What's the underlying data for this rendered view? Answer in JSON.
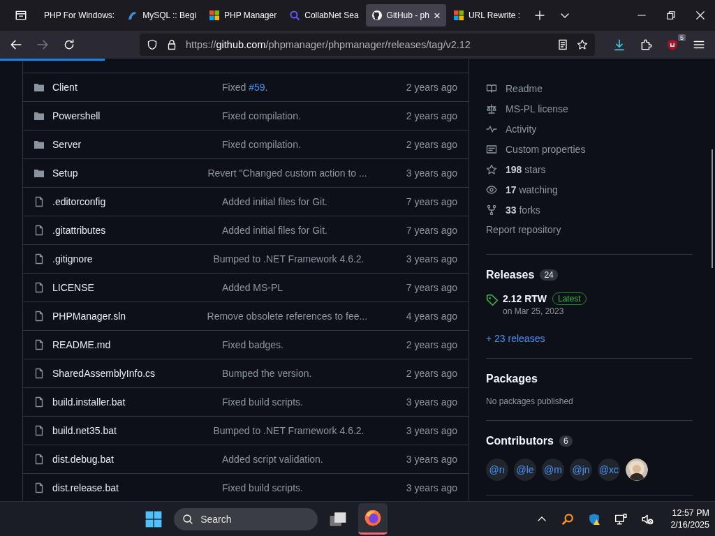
{
  "browser": {
    "tabs": [
      {
        "title": "PHP For Windows:",
        "selected": false
      },
      {
        "title": "MySQL :: Begi",
        "selected": false
      },
      {
        "title": "PHP Manager",
        "selected": false
      },
      {
        "title": "CollabNet Sea",
        "selected": false
      },
      {
        "title": "GitHub - ph",
        "selected": true,
        "close": "×"
      },
      {
        "title": "URL Rewrite :",
        "selected": false
      }
    ],
    "address": {
      "scheme": "https://",
      "domain": "github.com",
      "path": "/phpmanager/phpmanager/releases/tag/v2.12"
    },
    "extension_badge": "5"
  },
  "files": [
    {
      "kind": "folder",
      "name": "Client",
      "message": "Fixed ",
      "link": "#59",
      "message_end": ".",
      "date": "2 years ago"
    },
    {
      "kind": "folder",
      "name": "Powershell",
      "message": "Fixed compilation.",
      "date": "2 years ago"
    },
    {
      "kind": "folder",
      "name": "Server",
      "message": "Fixed compilation.",
      "date": "2 years ago"
    },
    {
      "kind": "folder",
      "name": "Setup",
      "message": "Revert \"Changed custom action to ...",
      "date": "3 years ago"
    },
    {
      "kind": "file",
      "name": ".editorconfig",
      "message": "Added initial files for Git.",
      "date": "7 years ago"
    },
    {
      "kind": "file",
      "name": ".gitattributes",
      "message": "Added initial files for Git.",
      "date": "7 years ago"
    },
    {
      "kind": "file",
      "name": ".gitignore",
      "message": "Bumped to .NET Framework 4.6.2.",
      "date": "3 years ago"
    },
    {
      "kind": "file",
      "name": "LICENSE",
      "message": "Added MS-PL",
      "date": "7 years ago"
    },
    {
      "kind": "file",
      "name": "PHPManager.sln",
      "message": "Remove obsolete references to fee...",
      "date": "4 years ago"
    },
    {
      "kind": "file",
      "name": "README.md",
      "message": "Fixed badges.",
      "date": "2 years ago"
    },
    {
      "kind": "file",
      "name": "SharedAssemblyInfo.cs",
      "message": "Bumped the version.",
      "date": "2 years ago"
    },
    {
      "kind": "file",
      "name": "build.installer.bat",
      "message": "Fixed build scripts.",
      "date": "3 years ago"
    },
    {
      "kind": "file",
      "name": "build.net35.bat",
      "message": "Bumped to .NET Framework 4.6.2.",
      "date": "3 years ago"
    },
    {
      "kind": "file",
      "name": "dist.debug.bat",
      "message": "Added script validation.",
      "date": "3 years ago"
    },
    {
      "kind": "file",
      "name": "dist.release.bat",
      "message": "Fixed build scripts.",
      "date": "3 years ago"
    }
  ],
  "about": {
    "items": [
      {
        "kind": "book",
        "label": "Readme"
      },
      {
        "kind": "scale",
        "label": "MS-PL license"
      },
      {
        "kind": "pulse",
        "label": "Activity"
      },
      {
        "kind": "note",
        "label": "Custom properties"
      },
      {
        "kind": "star",
        "label": "**198** stars"
      },
      {
        "kind": "eye",
        "label": "**17** watching"
      },
      {
        "kind": "fork",
        "label": "**33** forks"
      }
    ],
    "report": "Report repository"
  },
  "releases": {
    "title": "Releases",
    "count": "24",
    "latest": {
      "name": "2.12 RTW",
      "badge": "Latest",
      "date": "on Mar 25, 2023"
    },
    "more": "+ 23 releases"
  },
  "packages": {
    "title": "Packages",
    "note": "No packages published"
  },
  "contributors": {
    "title": "Contributors",
    "count": "6",
    "people": [
      {
        "kind": "handle",
        "label": "@rı"
      },
      {
        "kind": "handle",
        "label": "@le"
      },
      {
        "kind": "handle",
        "label": "@m"
      },
      {
        "kind": "handle",
        "label": "@jn"
      },
      {
        "kind": "handle",
        "label": "@xc"
      },
      {
        "kind": "picture"
      }
    ]
  },
  "taskbar": {
    "search": "Search",
    "time": "12:57 PM",
    "date": "2/16/2025"
  }
}
